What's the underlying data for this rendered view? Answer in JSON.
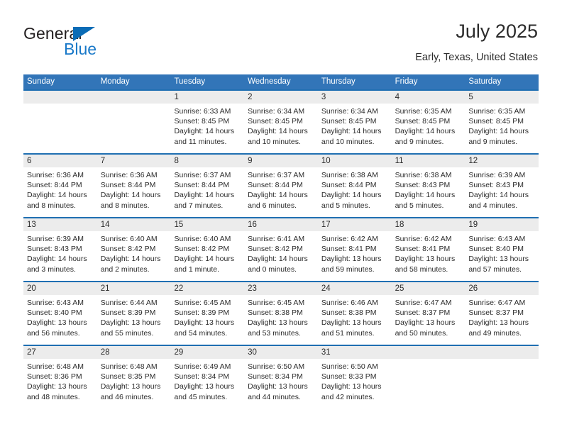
{
  "logo": {
    "text_primary": "General",
    "text_secondary": "Blue",
    "primary_color": "#231f20",
    "secondary_color": "#1878c8",
    "triangle_color": "#0b6cb6"
  },
  "header": {
    "title": "July 2025",
    "subtitle": "Early, Texas, United States"
  },
  "colors": {
    "header_bar": "#3275b8",
    "week_divider": "#1f6fb2",
    "daynum_band": "#ececec",
    "text": "#2b2b2b"
  },
  "weekdays": [
    "Sunday",
    "Monday",
    "Tuesday",
    "Wednesday",
    "Thursday",
    "Friday",
    "Saturday"
  ],
  "weeks": [
    {
      "days": [
        {
          "num": "",
          "sunrise": "",
          "sunset": "",
          "daylight1": "",
          "daylight2": ""
        },
        {
          "num": "",
          "sunrise": "",
          "sunset": "",
          "daylight1": "",
          "daylight2": ""
        },
        {
          "num": "1",
          "sunrise": "Sunrise: 6:33 AM",
          "sunset": "Sunset: 8:45 PM",
          "daylight1": "Daylight: 14 hours",
          "daylight2": "and 11 minutes."
        },
        {
          "num": "2",
          "sunrise": "Sunrise: 6:34 AM",
          "sunset": "Sunset: 8:45 PM",
          "daylight1": "Daylight: 14 hours",
          "daylight2": "and 10 minutes."
        },
        {
          "num": "3",
          "sunrise": "Sunrise: 6:34 AM",
          "sunset": "Sunset: 8:45 PM",
          "daylight1": "Daylight: 14 hours",
          "daylight2": "and 10 minutes."
        },
        {
          "num": "4",
          "sunrise": "Sunrise: 6:35 AM",
          "sunset": "Sunset: 8:45 PM",
          "daylight1": "Daylight: 14 hours",
          "daylight2": "and 9 minutes."
        },
        {
          "num": "5",
          "sunrise": "Sunrise: 6:35 AM",
          "sunset": "Sunset: 8:45 PM",
          "daylight1": "Daylight: 14 hours",
          "daylight2": "and 9 minutes."
        }
      ]
    },
    {
      "days": [
        {
          "num": "6",
          "sunrise": "Sunrise: 6:36 AM",
          "sunset": "Sunset: 8:44 PM",
          "daylight1": "Daylight: 14 hours",
          "daylight2": "and 8 minutes."
        },
        {
          "num": "7",
          "sunrise": "Sunrise: 6:36 AM",
          "sunset": "Sunset: 8:44 PM",
          "daylight1": "Daylight: 14 hours",
          "daylight2": "and 8 minutes."
        },
        {
          "num": "8",
          "sunrise": "Sunrise: 6:37 AM",
          "sunset": "Sunset: 8:44 PM",
          "daylight1": "Daylight: 14 hours",
          "daylight2": "and 7 minutes."
        },
        {
          "num": "9",
          "sunrise": "Sunrise: 6:37 AM",
          "sunset": "Sunset: 8:44 PM",
          "daylight1": "Daylight: 14 hours",
          "daylight2": "and 6 minutes."
        },
        {
          "num": "10",
          "sunrise": "Sunrise: 6:38 AM",
          "sunset": "Sunset: 8:44 PM",
          "daylight1": "Daylight: 14 hours",
          "daylight2": "and 5 minutes."
        },
        {
          "num": "11",
          "sunrise": "Sunrise: 6:38 AM",
          "sunset": "Sunset: 8:43 PM",
          "daylight1": "Daylight: 14 hours",
          "daylight2": "and 5 minutes."
        },
        {
          "num": "12",
          "sunrise": "Sunrise: 6:39 AM",
          "sunset": "Sunset: 8:43 PM",
          "daylight1": "Daylight: 14 hours",
          "daylight2": "and 4 minutes."
        }
      ]
    },
    {
      "days": [
        {
          "num": "13",
          "sunrise": "Sunrise: 6:39 AM",
          "sunset": "Sunset: 8:43 PM",
          "daylight1": "Daylight: 14 hours",
          "daylight2": "and 3 minutes."
        },
        {
          "num": "14",
          "sunrise": "Sunrise: 6:40 AM",
          "sunset": "Sunset: 8:42 PM",
          "daylight1": "Daylight: 14 hours",
          "daylight2": "and 2 minutes."
        },
        {
          "num": "15",
          "sunrise": "Sunrise: 6:40 AM",
          "sunset": "Sunset: 8:42 PM",
          "daylight1": "Daylight: 14 hours",
          "daylight2": "and 1 minute."
        },
        {
          "num": "16",
          "sunrise": "Sunrise: 6:41 AM",
          "sunset": "Sunset: 8:42 PM",
          "daylight1": "Daylight: 14 hours",
          "daylight2": "and 0 minutes."
        },
        {
          "num": "17",
          "sunrise": "Sunrise: 6:42 AM",
          "sunset": "Sunset: 8:41 PM",
          "daylight1": "Daylight: 13 hours",
          "daylight2": "and 59 minutes."
        },
        {
          "num": "18",
          "sunrise": "Sunrise: 6:42 AM",
          "sunset": "Sunset: 8:41 PM",
          "daylight1": "Daylight: 13 hours",
          "daylight2": "and 58 minutes."
        },
        {
          "num": "19",
          "sunrise": "Sunrise: 6:43 AM",
          "sunset": "Sunset: 8:40 PM",
          "daylight1": "Daylight: 13 hours",
          "daylight2": "and 57 minutes."
        }
      ]
    },
    {
      "days": [
        {
          "num": "20",
          "sunrise": "Sunrise: 6:43 AM",
          "sunset": "Sunset: 8:40 PM",
          "daylight1": "Daylight: 13 hours",
          "daylight2": "and 56 minutes."
        },
        {
          "num": "21",
          "sunrise": "Sunrise: 6:44 AM",
          "sunset": "Sunset: 8:39 PM",
          "daylight1": "Daylight: 13 hours",
          "daylight2": "and 55 minutes."
        },
        {
          "num": "22",
          "sunrise": "Sunrise: 6:45 AM",
          "sunset": "Sunset: 8:39 PM",
          "daylight1": "Daylight: 13 hours",
          "daylight2": "and 54 minutes."
        },
        {
          "num": "23",
          "sunrise": "Sunrise: 6:45 AM",
          "sunset": "Sunset: 8:38 PM",
          "daylight1": "Daylight: 13 hours",
          "daylight2": "and 53 minutes."
        },
        {
          "num": "24",
          "sunrise": "Sunrise: 6:46 AM",
          "sunset": "Sunset: 8:38 PM",
          "daylight1": "Daylight: 13 hours",
          "daylight2": "and 51 minutes."
        },
        {
          "num": "25",
          "sunrise": "Sunrise: 6:47 AM",
          "sunset": "Sunset: 8:37 PM",
          "daylight1": "Daylight: 13 hours",
          "daylight2": "and 50 minutes."
        },
        {
          "num": "26",
          "sunrise": "Sunrise: 6:47 AM",
          "sunset": "Sunset: 8:37 PM",
          "daylight1": "Daylight: 13 hours",
          "daylight2": "and 49 minutes."
        }
      ]
    },
    {
      "days": [
        {
          "num": "27",
          "sunrise": "Sunrise: 6:48 AM",
          "sunset": "Sunset: 8:36 PM",
          "daylight1": "Daylight: 13 hours",
          "daylight2": "and 48 minutes."
        },
        {
          "num": "28",
          "sunrise": "Sunrise: 6:48 AM",
          "sunset": "Sunset: 8:35 PM",
          "daylight1": "Daylight: 13 hours",
          "daylight2": "and 46 minutes."
        },
        {
          "num": "29",
          "sunrise": "Sunrise: 6:49 AM",
          "sunset": "Sunset: 8:34 PM",
          "daylight1": "Daylight: 13 hours",
          "daylight2": "and 45 minutes."
        },
        {
          "num": "30",
          "sunrise": "Sunrise: 6:50 AM",
          "sunset": "Sunset: 8:34 PM",
          "daylight1": "Daylight: 13 hours",
          "daylight2": "and 44 minutes."
        },
        {
          "num": "31",
          "sunrise": "Sunrise: 6:50 AM",
          "sunset": "Sunset: 8:33 PM",
          "daylight1": "Daylight: 13 hours",
          "daylight2": "and 42 minutes."
        },
        {
          "num": "",
          "sunrise": "",
          "sunset": "",
          "daylight1": "",
          "daylight2": ""
        },
        {
          "num": "",
          "sunrise": "",
          "sunset": "",
          "daylight1": "",
          "daylight2": ""
        }
      ]
    }
  ]
}
